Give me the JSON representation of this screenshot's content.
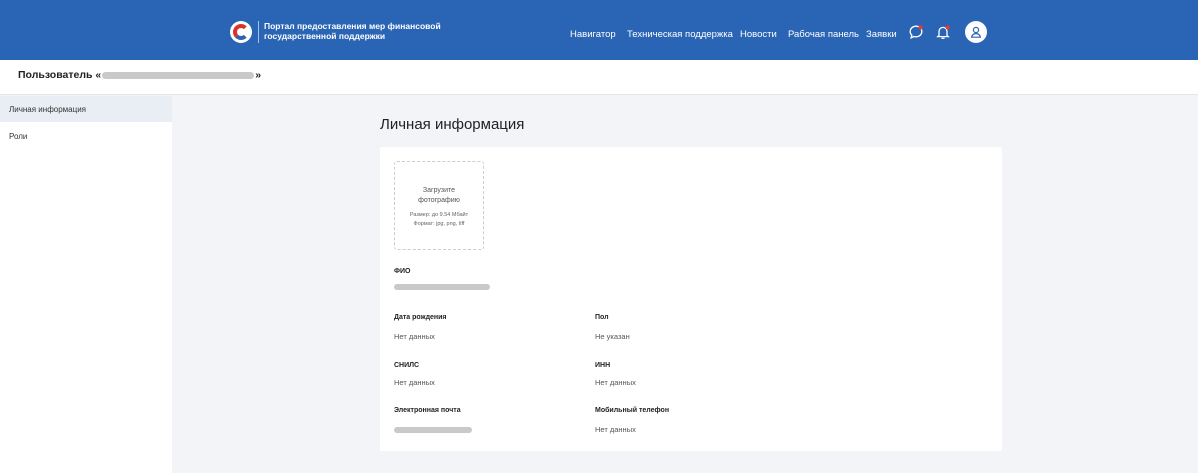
{
  "header": {
    "portal_title_line1": "Портал предоставления мер финансовой",
    "portal_title_line2": "государственной поддержки",
    "nav": [
      "Навигатор",
      "Техническая поддержка",
      "Новости",
      "Рабочая панель",
      "Заявки"
    ],
    "icons": [
      "chat-icon",
      "bell-icon",
      "user-icon"
    ],
    "brand_color": "#2a64b4",
    "logo_accent": "#d9342b"
  },
  "user_bar": {
    "prefix": "Пользователь «",
    "suffix": "»"
  },
  "sidebar": {
    "items": [
      {
        "label": "Личная информация",
        "active": true
      },
      {
        "label": "Роли",
        "active": false
      }
    ]
  },
  "main": {
    "title": "Личная информация",
    "upload": {
      "line1": "Загрузите",
      "line2": "фотографию",
      "size": "Размер: до 9.54 Мбайт",
      "format": "Формат: jpg, png, tiff"
    },
    "fields": {
      "fio_label": "ФИО",
      "birth_label": "Дата рождения",
      "birth_value": "Нет данных",
      "gender_label": "Пол",
      "gender_value": "Не указан",
      "snils_label": "СНИЛС",
      "snils_value": "Нет данных",
      "inn_label": "ИНН",
      "inn_value": "Нет данных",
      "email_label": "Электронная почта",
      "phone_label": "Мобильный телефон",
      "phone_value": "Нет данных"
    }
  }
}
